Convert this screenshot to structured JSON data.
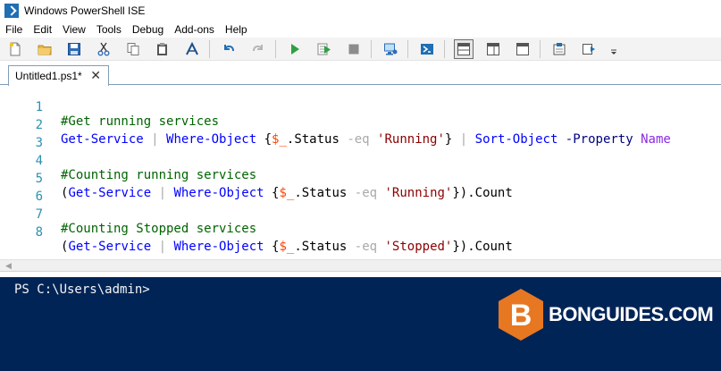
{
  "window": {
    "title": "Windows PowerShell ISE"
  },
  "menu": [
    "File",
    "Edit",
    "View",
    "Tools",
    "Debug",
    "Add-ons",
    "Help"
  ],
  "toolbar": {
    "icons": [
      "new-file-icon",
      "open-folder-icon",
      "save-icon",
      "cut-icon",
      "copy-icon",
      "paste-icon",
      "clear-icon",
      "undo-icon",
      "redo-icon",
      "run-icon",
      "run-selection-icon",
      "stop-icon",
      "new-remote-tab-icon",
      "start-powershell-icon",
      "show-script-top-icon",
      "show-script-right-icon",
      "show-script-max-icon",
      "show-command-window-icon",
      "show-command-addon-icon",
      "toolbar-overflow-icon"
    ]
  },
  "tab": {
    "label": "Untitled1.ps1*",
    "close": "✕"
  },
  "editor": {
    "lines": [
      {
        "n": "1"
      },
      {
        "n": "2"
      },
      {
        "n": "3"
      },
      {
        "n": "4"
      },
      {
        "n": "5"
      },
      {
        "n": "6"
      },
      {
        "n": "7"
      },
      {
        "n": "8"
      }
    ],
    "code": {
      "l1_comment": "#Get running services",
      "l2_cmd1": "Get-Service",
      "l2_pipe1": " | ",
      "l2_cmd2": "Where-Object",
      "l2_b1": " {",
      "l2_var": "$_",
      "l2_prop": ".Status ",
      "l2_param": "-eq",
      "l2_str": " 'Running'",
      "l2_b2": "}",
      "l2_pipe2": " | ",
      "l2_cmd3": "Sort-Object",
      "l2_param2": " -Property",
      "l2_arg": " Name",
      "l4_comment": "#Counting running services",
      "l5_open": "(",
      "l5_cmd1": "Get-Service",
      "l5_pipe": " | ",
      "l5_cmd2": "Where-Object",
      "l5_b1": " {",
      "l5_var": "$_",
      "l5_prop": ".Status ",
      "l5_param": "-eq",
      "l5_str": " 'Running'",
      "l5_close": "}).Count",
      "l7_comment": "#Counting Stopped services",
      "l8_open": "(",
      "l8_cmd1": "Get-Service",
      "l8_pipe": " | ",
      "l8_cmd2": "Where-Object",
      "l8_b1": " {",
      "l8_var": "$_",
      "l8_prop": ".Status ",
      "l8_param": "-eq",
      "l8_str": " 'Stopped'",
      "l8_close": "}).Count"
    }
  },
  "console": {
    "prompt": "PS C:\\Users\\admin>",
    "background": "#012456"
  },
  "watermark": {
    "letter": "B",
    "text": "BONGUIDES.COM",
    "color": "#e87722"
  }
}
